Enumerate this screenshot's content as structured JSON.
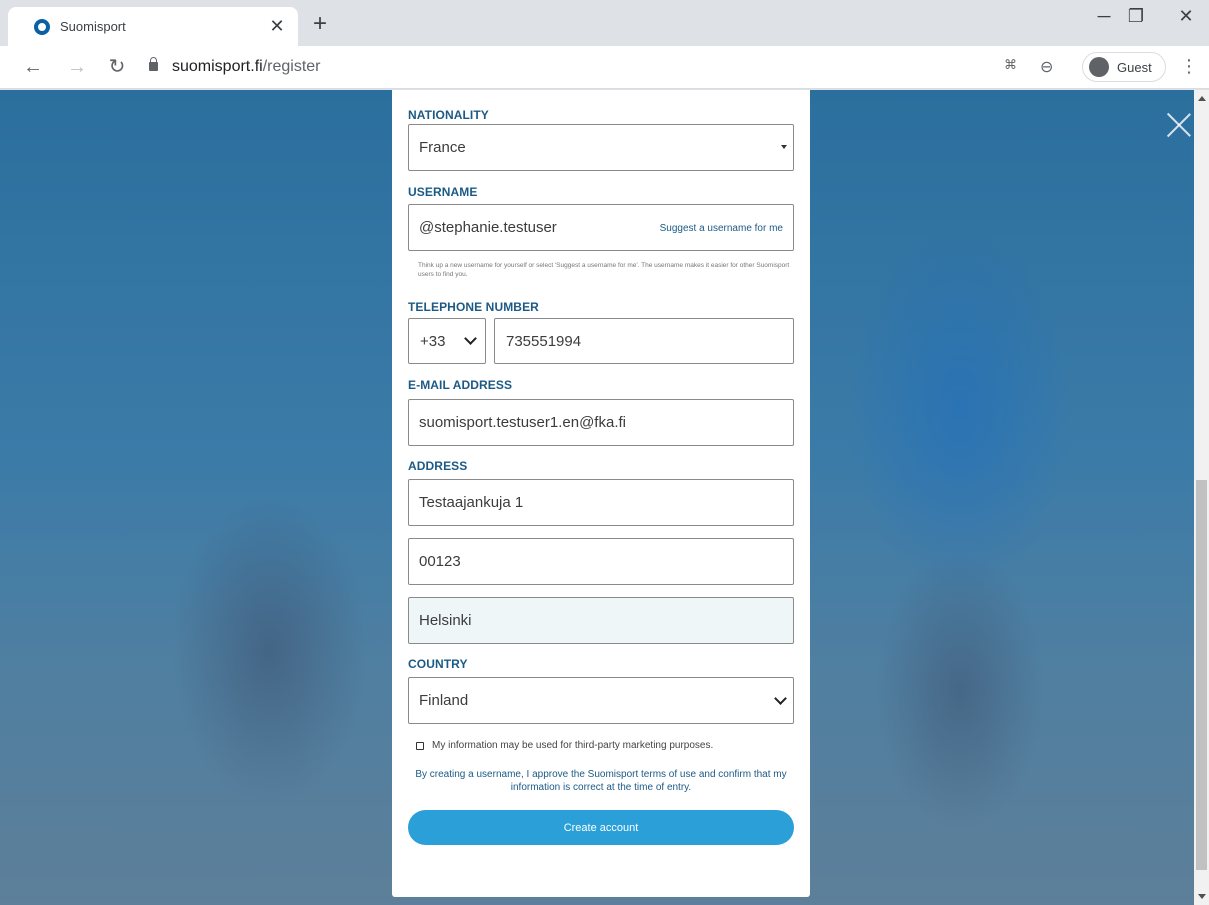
{
  "browser": {
    "tab_title": "Suomisport",
    "url_domain": "suomisport.fi",
    "url_path": "/register",
    "profile_label": "Guest"
  },
  "form": {
    "nationality": {
      "label": "NATIONALITY",
      "value": "France"
    },
    "username": {
      "label": "USERNAME",
      "value": "@stephanie.testuser",
      "suggest_label": "Suggest a username for me",
      "hint": "Think up a new username for yourself or select 'Suggest a username for me'. The username makes it easier for other Suomisport users to find you."
    },
    "telephone": {
      "label": "TELEPHONE NUMBER",
      "prefix": "+33",
      "number": "735551994"
    },
    "email": {
      "label": "E-MAIL ADDRESS",
      "value": "suomisport.testuser1.en@fka.fi"
    },
    "address": {
      "label": "ADDRESS",
      "street": "Testaajankuja 1",
      "postal_code": "00123",
      "city": "Helsinki"
    },
    "country": {
      "label": "COUNTRY",
      "value": "Finland"
    },
    "marketing_consent": {
      "label": "My information may be used for third-party marketing purposes.",
      "checked": false
    },
    "terms_text": "By creating a username, I approve the Suomisport terms of use and confirm that my information is correct at the time of entry.",
    "submit_label": "Create account"
  },
  "colors": {
    "accent": "#2a9fd8",
    "label": "#1c5a86"
  }
}
